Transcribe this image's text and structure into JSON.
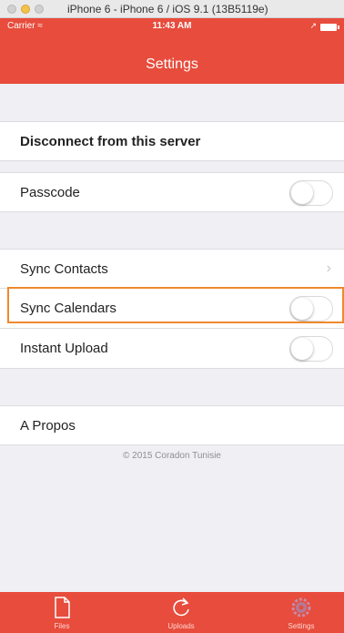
{
  "window": {
    "title": "iPhone 6 - iPhone 6 / iOS 9.1 (13B5119e)"
  },
  "status_bar": {
    "carrier": "Carrier",
    "time": "11:43 AM"
  },
  "nav": {
    "title": "Settings"
  },
  "rows": {
    "disconnect": "Disconnect from this server",
    "passcode": "Passcode",
    "sync_contacts": "Sync Contacts",
    "sync_calendars": "Sync Calendars",
    "instant_upload": "Instant Upload",
    "about": "A Propos"
  },
  "toggles": {
    "passcode": false,
    "sync_calendars": false,
    "instant_upload": false
  },
  "footer": {
    "copyright": "© 2015 Coradon Tunisie"
  },
  "tabs": {
    "files": "Files",
    "uploads": "Uploads",
    "settings": "Settings"
  },
  "icons": {
    "files": "file-icon",
    "uploads": "refresh-icon",
    "settings": "gear-icon"
  },
  "colors": {
    "brand": "#e74c3c",
    "highlight": "#f0892c",
    "background": "#efeff4"
  }
}
